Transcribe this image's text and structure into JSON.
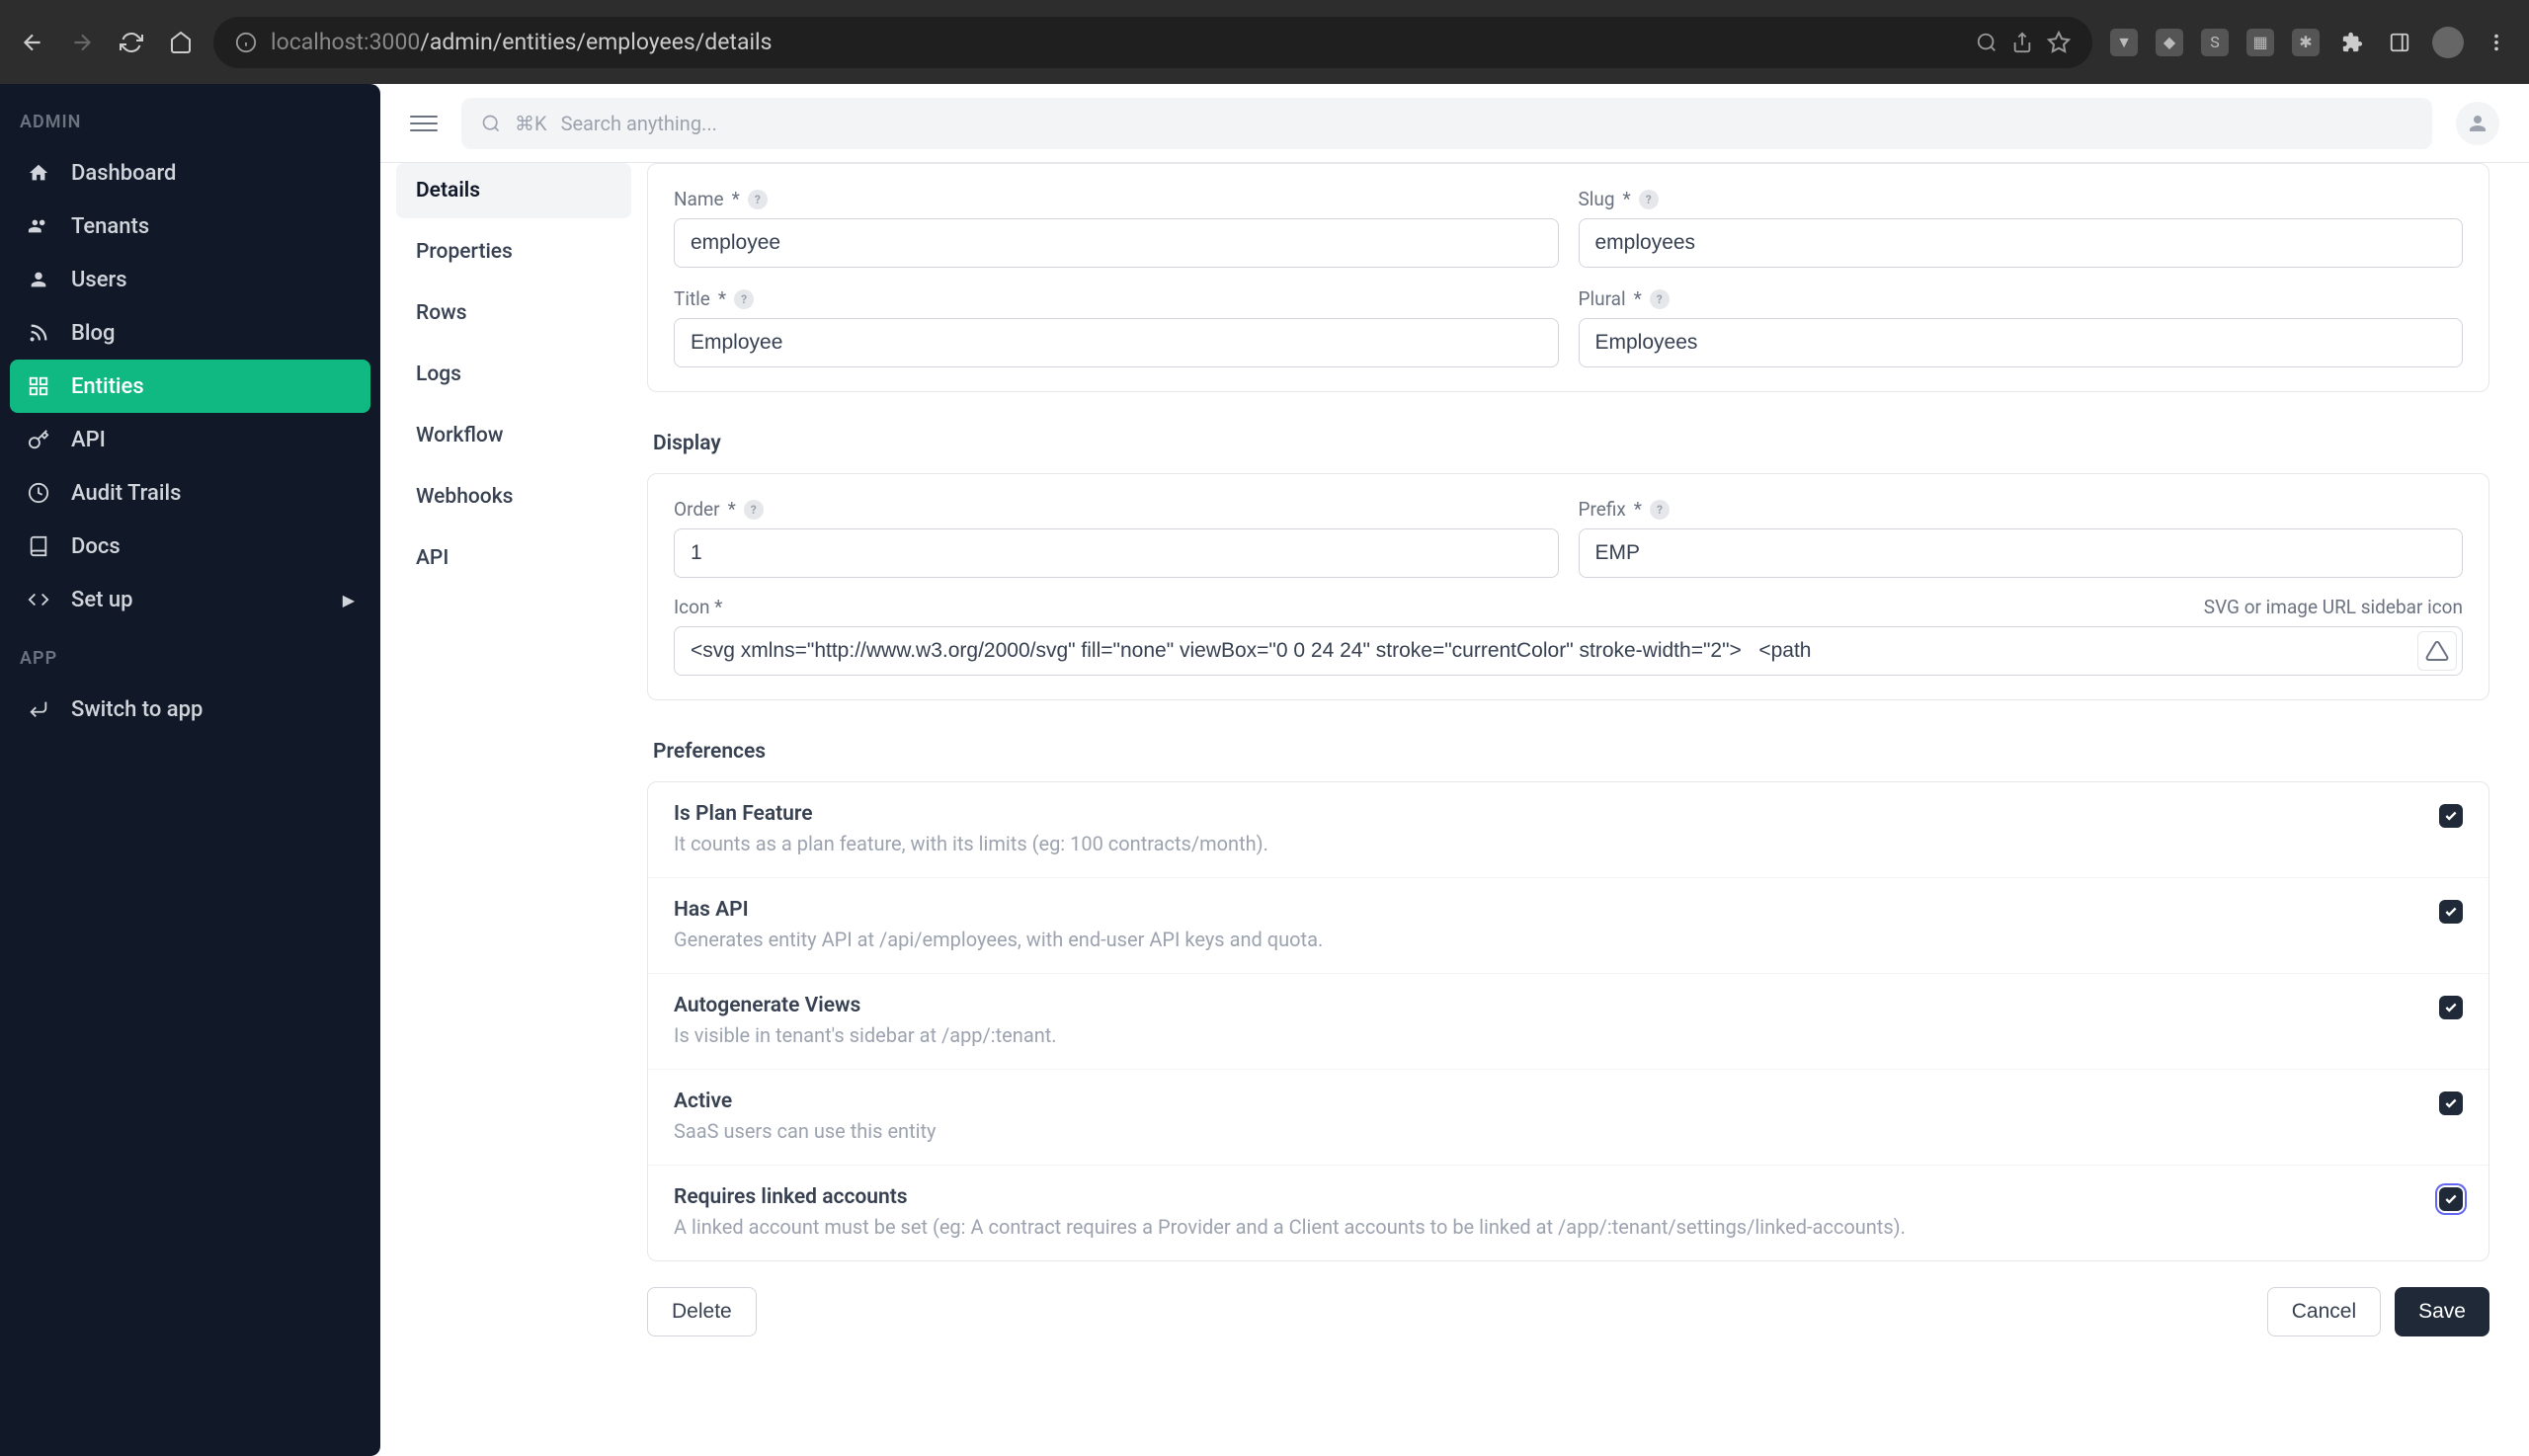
{
  "browser": {
    "url_prefix": "localhost",
    "url_port": ":3000",
    "url_path": "/admin/entities/employees/details"
  },
  "sidebar": {
    "section_admin": "ADMIN",
    "section_app": "APP",
    "items": [
      {
        "label": "Dashboard"
      },
      {
        "label": "Tenants"
      },
      {
        "label": "Users"
      },
      {
        "label": "Blog"
      },
      {
        "label": "Entities"
      },
      {
        "label": "API"
      },
      {
        "label": "Audit Trails"
      },
      {
        "label": "Docs"
      },
      {
        "label": "Set up"
      }
    ],
    "switch_label": "Switch to app"
  },
  "topbar": {
    "search_shortcut": "⌘K",
    "search_placeholder": "Search anything..."
  },
  "subnav": [
    {
      "label": "Details"
    },
    {
      "label": "Properties"
    },
    {
      "label": "Rows"
    },
    {
      "label": "Logs"
    },
    {
      "label": "Workflow"
    },
    {
      "label": "Webhooks"
    },
    {
      "label": "API"
    }
  ],
  "form": {
    "name_label": "Name",
    "name_value": "employee",
    "slug_label": "Slug",
    "slug_value": "employees",
    "title_label": "Title",
    "title_value": "Employee",
    "plural_label": "Plural",
    "plural_value": "Employees",
    "display_section": "Display",
    "order_label": "Order",
    "order_value": "1",
    "prefix_label": "Prefix",
    "prefix_value": "EMP",
    "icon_label": "Icon",
    "icon_hint": "SVG or image URL sidebar icon",
    "icon_value": "<svg xmlns=\"http://www.w3.org/2000/svg\" fill=\"none\" viewBox=\"0 0 24 24\" stroke=\"currentColor\" stroke-width=\"2\">   <path",
    "prefs_section": "Preferences",
    "prefs": [
      {
        "title": "Is Plan Feature",
        "desc": "It counts as a plan feature, with its limits (eg: 100 contracts/month).",
        "checked": true
      },
      {
        "title": "Has API",
        "desc": "Generates entity API at /api/employees, with end-user API keys and quota.",
        "checked": true
      },
      {
        "title": "Autogenerate Views",
        "desc": "Is visible in tenant's sidebar at /app/:tenant.",
        "checked": true
      },
      {
        "title": "Active",
        "desc": "SaaS users can use this entity",
        "checked": true
      },
      {
        "title": "Requires linked accounts",
        "desc": "A linked account must be set (eg: A contract requires a Provider and a Client accounts to be linked at /app/:tenant/settings/linked-accounts).",
        "checked": true
      }
    ],
    "delete_label": "Delete",
    "cancel_label": "Cancel",
    "save_label": "Save"
  }
}
